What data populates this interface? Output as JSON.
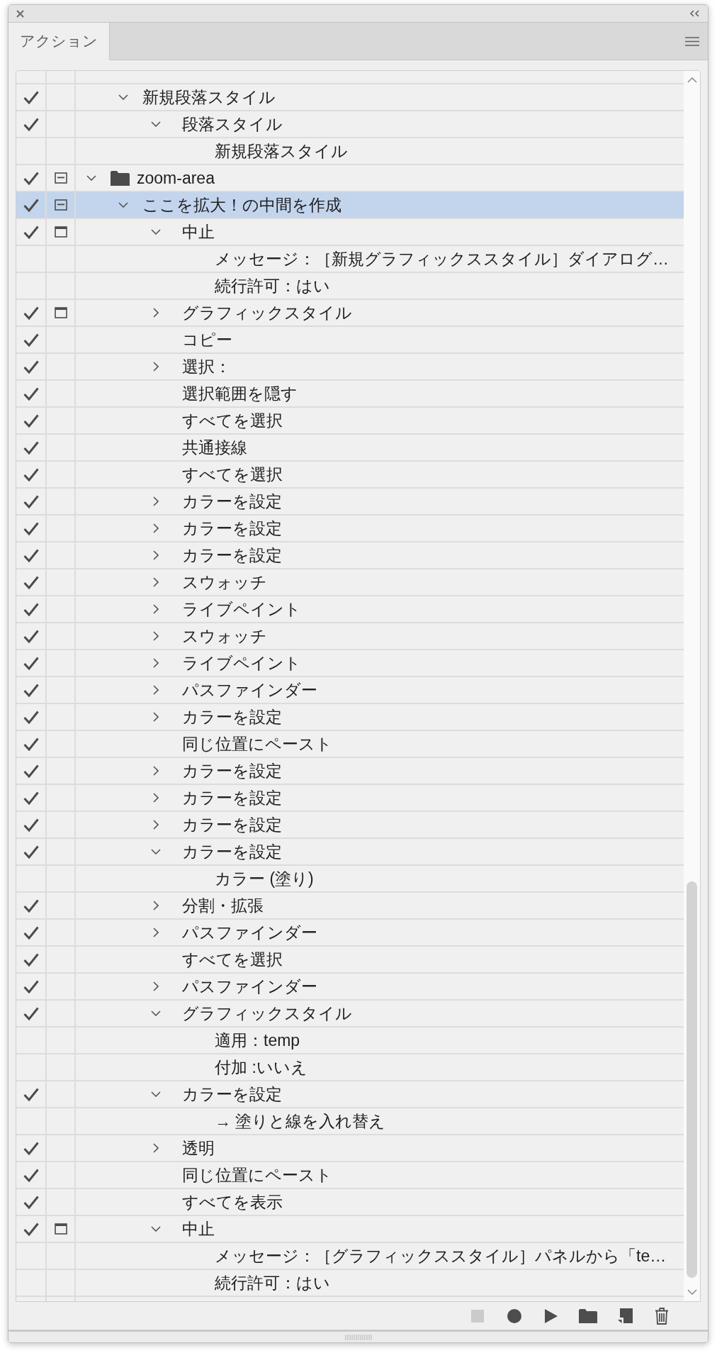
{
  "panel": {
    "tabs": [
      {
        "label": "アクション",
        "selected": true
      }
    ]
  },
  "actions": {
    "tree": [
      {
        "children": [
          {
            "label": "新規段落スタイル",
            "checked": true,
            "dialog": false,
            "expanded": true,
            "selected": false,
            "children": [
              {
                "label": "段落スタイル",
                "checked": true,
                "dialog": false,
                "expanded": true,
                "selected": false,
                "children": [
                  {
                    "label": "新規段落スタイル",
                    "checked": false,
                    "dialog": false,
                    "selected": false
                  }
                ]
              }
            ]
          }
        ]
      },
      {
        "label": "zoom-area",
        "checked": true,
        "dialog": true,
        "dialog_mixed": true,
        "expanded": true,
        "selected": false,
        "children": [
          {
            "label": "ここを拡大！の中間を作成",
            "checked": true,
            "dialog": true,
            "dialog_mixed": true,
            "expanded": true,
            "selected": true,
            "children": [
              {
                "label": "中止",
                "checked": true,
                "dialog": true,
                "expanded": true,
                "selected": false,
                "children": [
                  {
                    "label": "メッセージ：［新規グラフィックススタイル］ダイアログ…",
                    "checked": false,
                    "dialog": false,
                    "selected": false
                  },
                  {
                    "label": "続行許可：はい",
                    "checked": false,
                    "dialog": false,
                    "selected": false
                  }
                ]
              },
              {
                "label": "グラフィックスタイル",
                "checked": true,
                "dialog": true,
                "expanded": false,
                "selected": false
              },
              {
                "label": "コピー",
                "checked": true,
                "dialog": false,
                "selected": false
              },
              {
                "label": "選択：",
                "checked": true,
                "dialog": false,
                "expanded": false,
                "selected": false
              },
              {
                "label": "選択範囲を隠す",
                "checked": true,
                "dialog": false,
                "selected": false
              },
              {
                "label": "すべてを選択",
                "checked": true,
                "dialog": false,
                "selected": false
              },
              {
                "label": "共通接線",
                "checked": true,
                "dialog": false,
                "selected": false
              },
              {
                "label": "すべてを選択",
                "checked": true,
                "dialog": false,
                "selected": false
              },
              {
                "label": "カラーを設定",
                "checked": true,
                "dialog": false,
                "expanded": false,
                "selected": false
              },
              {
                "label": "カラーを設定",
                "checked": true,
                "dialog": false,
                "expanded": false,
                "selected": false
              },
              {
                "label": "カラーを設定",
                "checked": true,
                "dialog": false,
                "expanded": false,
                "selected": false
              },
              {
                "label": "スウォッチ",
                "checked": true,
                "dialog": false,
                "expanded": false,
                "selected": false
              },
              {
                "label": "ライブペイント",
                "checked": true,
                "dialog": false,
                "expanded": false,
                "selected": false
              },
              {
                "label": "スウォッチ",
                "checked": true,
                "dialog": false,
                "expanded": false,
                "selected": false
              },
              {
                "label": "ライブペイント",
                "checked": true,
                "dialog": false,
                "expanded": false,
                "selected": false
              },
              {
                "label": "パスファインダー",
                "checked": true,
                "dialog": false,
                "expanded": false,
                "selected": false
              },
              {
                "label": "カラーを設定",
                "checked": true,
                "dialog": false,
                "expanded": false,
                "selected": false
              },
              {
                "label": "同じ位置にペースト",
                "checked": true,
                "dialog": false,
                "selected": false
              },
              {
                "label": "カラーを設定",
                "checked": true,
                "dialog": false,
                "expanded": false,
                "selected": false
              },
              {
                "label": "カラーを設定",
                "checked": true,
                "dialog": false,
                "expanded": false,
                "selected": false
              },
              {
                "label": "カラーを設定",
                "checked": true,
                "dialog": false,
                "expanded": false,
                "selected": false
              },
              {
                "label": "カラーを設定",
                "checked": true,
                "dialog": false,
                "expanded": true,
                "selected": false,
                "children": [
                  {
                    "label": "カラー (塗り)",
                    "checked": false,
                    "dialog": false,
                    "selected": false
                  }
                ]
              },
              {
                "label": "分割・拡張",
                "checked": true,
                "dialog": false,
                "expanded": false,
                "selected": false
              },
              {
                "label": "パスファインダー",
                "checked": true,
                "dialog": false,
                "expanded": false,
                "selected": false
              },
              {
                "label": "すべてを選択",
                "checked": true,
                "dialog": false,
                "selected": false
              },
              {
                "label": "パスファインダー",
                "checked": true,
                "dialog": false,
                "expanded": false,
                "selected": false
              },
              {
                "label": "グラフィックスタイル",
                "checked": true,
                "dialog": false,
                "expanded": true,
                "selected": false,
                "children": [
                  {
                    "label": "適用：temp",
                    "checked": false,
                    "dialog": false,
                    "selected": false
                  },
                  {
                    "label": "付加 :いいえ",
                    "checked": false,
                    "dialog": false,
                    "selected": false
                  }
                ]
              },
              {
                "label": "カラーを設定",
                "checked": true,
                "dialog": false,
                "expanded": true,
                "selected": false,
                "children": [
                  {
                    "label": "→ 塗りと線を入れ替え",
                    "checked": false,
                    "dialog": false,
                    "selected": false
                  }
                ]
              },
              {
                "label": "透明",
                "checked": true,
                "dialog": false,
                "expanded": false,
                "selected": false
              },
              {
                "label": "同じ位置にペースト",
                "checked": true,
                "dialog": false,
                "selected": false
              },
              {
                "label": "すべてを表示",
                "checked": true,
                "dialog": false,
                "selected": false
              },
              {
                "label": "中止",
                "checked": true,
                "dialog": true,
                "expanded": true,
                "selected": false,
                "children": [
                  {
                    "label": "メッセージ：［グラフィックススタイル］パネルから「te…",
                    "checked": false,
                    "dialog": false,
                    "selected": false
                  },
                  {
                    "label": "続行許可：はい",
                    "checked": false,
                    "dialog": false,
                    "selected": false
                  }
                ]
              }
            ]
          }
        ]
      }
    ]
  },
  "toolbar": [
    {
      "kind": "stop",
      "disabled": true
    },
    {
      "kind": "record",
      "disabled": false
    },
    {
      "kind": "play",
      "disabled": false
    },
    {
      "kind": "new-set",
      "disabled": false
    },
    {
      "kind": "new-action",
      "disabled": false
    },
    {
      "kind": "delete",
      "disabled": false
    }
  ]
}
